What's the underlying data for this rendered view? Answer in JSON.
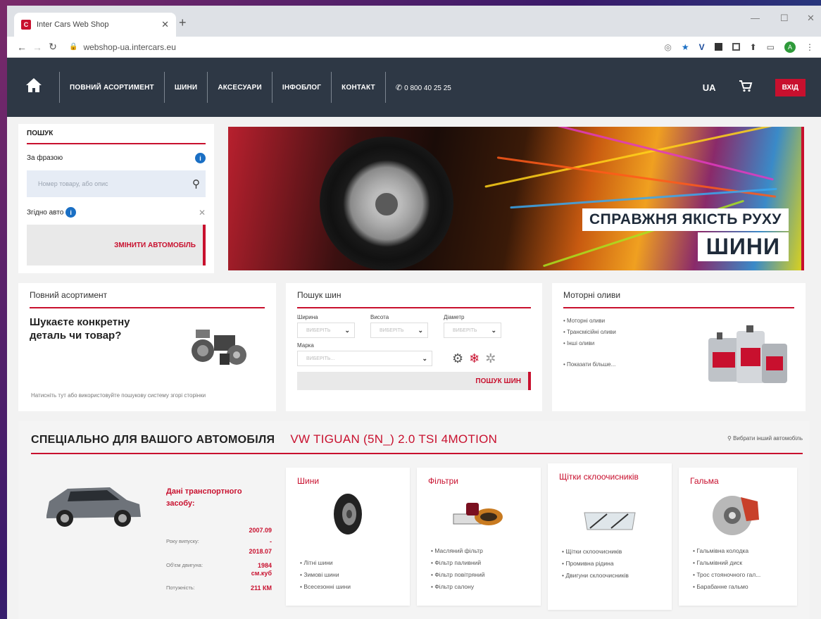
{
  "browser": {
    "tab_title": "Inter Cars Web Shop",
    "tab_close": "✕",
    "new_tab": "+",
    "url": "webshop-ua.intercars.eu",
    "min": "—",
    "max": "☐",
    "close": "✕",
    "profile": "A"
  },
  "header": {
    "nav": [
      "ПОВНИЙ АСОРТИМЕНТ",
      "ШИНИ",
      "АКСЕСУАРИ",
      "ІНФОБЛОГ",
      "КОНТАКТ"
    ],
    "phone": "0 800 40 25 25",
    "lang": "UA",
    "login": "ВХІД"
  },
  "search": {
    "title": "ПОШУК",
    "by_phrase": "За фразою",
    "placeholder": "Номер товару, або опис",
    "by_car": "Згідно авто",
    "change_car": "ЗМІНИТИ АВТОМОБІЛЬ"
  },
  "banner": {
    "tagline": "СПРАВЖНЯ ЯКІСТЬ РУХУ",
    "word": "ШИНИ"
  },
  "full_range": {
    "title": "Повний асортимент",
    "question": "Шукаєте конкретну деталь чи товар?",
    "note": "Натисніть тут або використовуйте пошукову систему згорі сторінки"
  },
  "tire_search": {
    "title": "Пошук шин",
    "width_label": "Ширина",
    "height_label": "Висота",
    "diameter_label": "Діаметр",
    "select_placeholder": "ВИБЕРІТЬ",
    "brand_label": "Марка",
    "brand_placeholder": "ВИБЕРІТЬ...",
    "button": "ПОШУК ШИН"
  },
  "oils": {
    "title": "Моторні оливи",
    "items": [
      "Моторні оливи",
      "Трансмісійні оливи",
      "Інші оливи"
    ],
    "more": "Показати більше..."
  },
  "special": {
    "title": "СПЕЦІАЛЬНО ДЛЯ ВАШОГО АВТОМОБІЛЯ",
    "car": "VW TIGUAN (5N_) 2.0 TSI 4MOTION",
    "other_car": "Вибрати інший автомобіль",
    "vehicle": {
      "title": "Дані транспортного засобу:",
      "year_label": "Року випуску:",
      "year_from": "2007.09",
      "year_sep": "-",
      "year_to": "2018.07",
      "engine_label": "Об'єм двигуна:",
      "engine_value": "1984 см.куб",
      "power_label": "Потужність:",
      "power_value": "211 КМ"
    },
    "cards": [
      {
        "title": "Шини",
        "items": [
          "Літні шини",
          "Зимові шини",
          "Всесезонні шини"
        ]
      },
      {
        "title": "Фільтри",
        "items": [
          "Масляний фільтр",
          "Фільтр паливний",
          "Фільтр повітряний",
          "Фільтр салону"
        ]
      },
      {
        "title": "Щітки склоочисників",
        "items": [
          "Щітки склоочисників",
          "Промивна рідина",
          "Двигуни склоочисників"
        ]
      },
      {
        "title": "Гальма",
        "items": [
          "Гальмівна колодка",
          "Гальмівний диск",
          "Трос стояночного гал...",
          "Барабанне гальмо"
        ]
      }
    ]
  },
  "colors": {
    "accent": "#c8102e",
    "header": "#2e3845"
  }
}
